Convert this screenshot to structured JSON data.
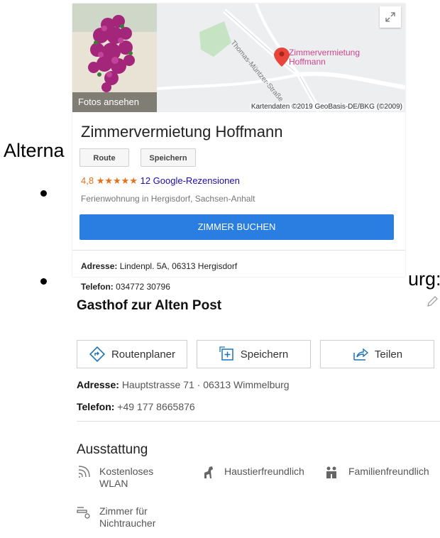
{
  "slide": {
    "heading_fragment": "Alterna",
    "bullet2_fragment": "urg:"
  },
  "google_card": {
    "photo_caption": "Fotos ansehen",
    "map": {
      "pin_label": "Zimmervermietung Hoffmann",
      "street_label": "Thomas-Müntzer-Straße",
      "credit": "Kartendaten ©2019 GeoBasis-DE/BKG (©2009)",
      "expand_icon": "expand-icon"
    },
    "title": "Zimmervermietung Hoffmann",
    "route_label": "Route",
    "save_label": "Speichern",
    "rating": "4,8",
    "stars": "★★★★★",
    "reviews": "12 Google-Rezensionen",
    "category": "Ferienwohnung in Hergisdorf, Sachsen-Anhalt",
    "book_label": "ZIMMER BUCHEN",
    "address_label": "Adresse:",
    "address": "Lindenpl. 5A, 06313 Hergisdorf",
    "phone_label": "Telefon:",
    "phone": "034772 30796",
    "colors": {
      "accent": "#2a7de1",
      "pin": "#e8453c",
      "stars": "#e7711b"
    }
  },
  "bing_card": {
    "title": "Gasthof zur Alten Post",
    "buttons": {
      "route": "Routenplaner",
      "save": "Speichern",
      "share": "Teilen"
    },
    "address_label": "Adresse:",
    "address": "Hauptstrasse 71 · 06313 Wimmelburg",
    "phone_label": "Telefon:",
    "phone": "+49 177 8665876",
    "amenities_title": "Ausstattung",
    "amenities": {
      "wifi_line1": "Kostenloses",
      "wifi_line2": "WLAN",
      "pets": "Haustierfreundlich",
      "family": "Familienfreundlich",
      "nonsmoking_line1": "Zimmer für",
      "nonsmoking_line2": "Nichtraucher"
    }
  }
}
